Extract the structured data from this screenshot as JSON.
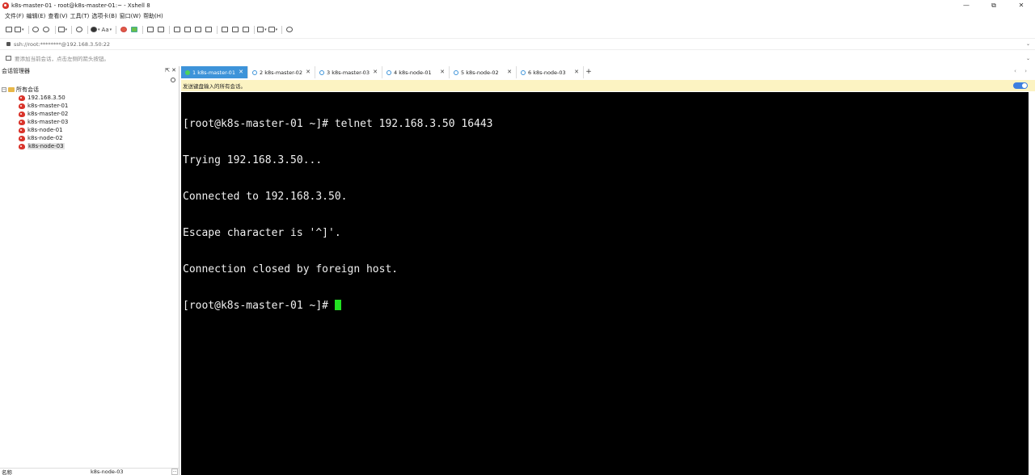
{
  "window": {
    "title": "k8s-master-01 - root@k8s-master-01:~ - Xshell 8",
    "controls": {
      "minimize": "—",
      "maximize": "⧉",
      "close": "✕"
    }
  },
  "menu": [
    "文件(F)",
    "编辑(E)",
    "查看(V)",
    "工具(T)",
    "选项卡(B)",
    "窗口(W)",
    "帮助(H)"
  ],
  "toolbar": {
    "font_label": "Aa"
  },
  "address": {
    "value": "ssh://root:********@192.168.3.50:22",
    "caret": "⌄"
  },
  "hint": {
    "text": "要添加当前会话，点击左侧的箭头按钮。",
    "caret": "⌄"
  },
  "session_panel": {
    "title": "会话管理器",
    "pin": "⇱",
    "close": "✕",
    "root_toggle": "−",
    "root_label": "所有会话",
    "items": [
      {
        "label": "192.168.3.50"
      },
      {
        "label": "k8s-master-01"
      },
      {
        "label": "k8s-master-02"
      },
      {
        "label": "k8s-master-03"
      },
      {
        "label": "k8s-node-01"
      },
      {
        "label": "k8s-node-02"
      },
      {
        "label": "k8s-node-03"
      }
    ],
    "footer": {
      "name_label": "名称",
      "name_value": "k8s-node-03",
      "more": "..."
    }
  },
  "tabs": [
    {
      "label": "1 k8s-master-01",
      "close": "✕"
    },
    {
      "label": "2 k8s-master-02",
      "close": "✕"
    },
    {
      "label": "3 k8s-master-03",
      "close": "✕"
    },
    {
      "label": "4 k8s-node-01",
      "close": "✕"
    },
    {
      "label": "5 k8s-node-02",
      "close": "✕"
    },
    {
      "label": "6 k8s-node-03",
      "close": "✕"
    }
  ],
  "tab_add": "+",
  "tab_nav": "‹ ›",
  "broadcast": {
    "text": "发送键盘输入的所有会话。"
  },
  "terminal": {
    "lines": [
      "[root@k8s-master-01 ~]# telnet 192.168.3.50 16443",
      "Trying 192.168.3.50...",
      "Connected to 192.168.3.50.",
      "Escape character is '^]'.",
      "Connection closed by foreign host.",
      "[root@k8s-master-01 ~]# "
    ]
  },
  "colors": {
    "active_tab": "#3d93d9",
    "broadcast_bg": "#fcf3c2",
    "cursor": "#22e022",
    "session_icon": "#d9342b"
  }
}
